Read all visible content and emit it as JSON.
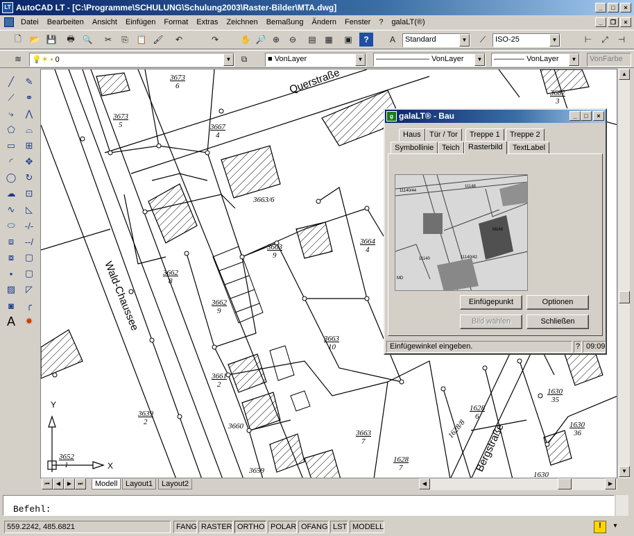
{
  "window": {
    "title": "AutoCAD LT - [C:\\Programme\\SCHULUNG\\Schulung2003\\Raster-Bilder\\MTA.dwg]",
    "app_icon": "LT"
  },
  "menu": {
    "items": [
      "Datei",
      "Bearbeiten",
      "Ansicht",
      "Einfügen",
      "Format",
      "Extras",
      "Zeichnen",
      "Bemaßung",
      "Ändern",
      "Fenster",
      "?",
      "galaLT(®)"
    ]
  },
  "toolbar": {
    "textstyle": "Standard",
    "dimstyle": "ISO-25"
  },
  "properties": {
    "layer": "0",
    "color": "VonLayer",
    "linetype": "VonLayer",
    "lineweight": "VonLayer",
    "plotstyle": "VonFarbe"
  },
  "drawing": {
    "street_labels": {
      "querstrasse": "Querstraße",
      "wald_chaussee": "Wald-Chaussee",
      "bergstrasse": "Bergstraße"
    },
    "parcels": [
      {
        "num": "3673",
        "sub": "6"
      },
      {
        "num": "3673",
        "sub": "5"
      },
      {
        "num": "3667",
        "sub": "4"
      },
      {
        "num": "3663/6",
        "sub": ""
      },
      {
        "num": "3663",
        "sub": "9"
      },
      {
        "num": "3664",
        "sub": "4"
      },
      {
        "num": "3662",
        "sub": "8"
      },
      {
        "num": "3662",
        "sub": "9"
      },
      {
        "num": "3663",
        "sub": "10"
      },
      {
        "num": "3661",
        "sub": "2"
      },
      {
        "num": "3660",
        "sub": ""
      },
      {
        "num": "3659",
        "sub": ""
      },
      {
        "num": "3663",
        "sub": "7"
      },
      {
        "num": "3639",
        "sub": "2"
      },
      {
        "num": "3652",
        "sub": "1"
      },
      {
        "num": "1628",
        "sub": "7"
      },
      {
        "num": "1628",
        "sub": "6"
      },
      {
        "num": "1628/8",
        "sub": ""
      },
      {
        "num": "1630",
        "sub": "35"
      },
      {
        "num": "1630",
        "sub": "36"
      },
      {
        "num": "1630",
        "sub": ""
      },
      {
        "num": "3687",
        "sub": "3"
      }
    ],
    "ucs": {
      "x": "X",
      "y": "Y"
    }
  },
  "layout_tabs": [
    "Modell",
    "Layout1",
    "Layout2"
  ],
  "command": {
    "prompt": "Befehl:"
  },
  "status": {
    "coords": "559.2242, 485.6821",
    "toggles": [
      "FANG",
      "RASTER",
      "ORTHO",
      "POLAR",
      "OFANG",
      "LST",
      "MODELL"
    ]
  },
  "dialog": {
    "title": "galaLT® - Bau",
    "tabs_row1": [
      "Haus",
      "Tür / Tor",
      "Treppe 1",
      "Treppe 2"
    ],
    "tabs_row2": [
      "Symbollinie",
      "Teich",
      "Rasterbild",
      "TextLabel"
    ],
    "active_tab": "Rasterbild",
    "buttons": {
      "insert_point": "Einfügepunkt",
      "options": "Optionen",
      "choose_image": "Bild wählen",
      "close": "Schließen"
    },
    "status_text": "Einfügewinkel eingeben.",
    "help": "?",
    "time": "09:09"
  }
}
